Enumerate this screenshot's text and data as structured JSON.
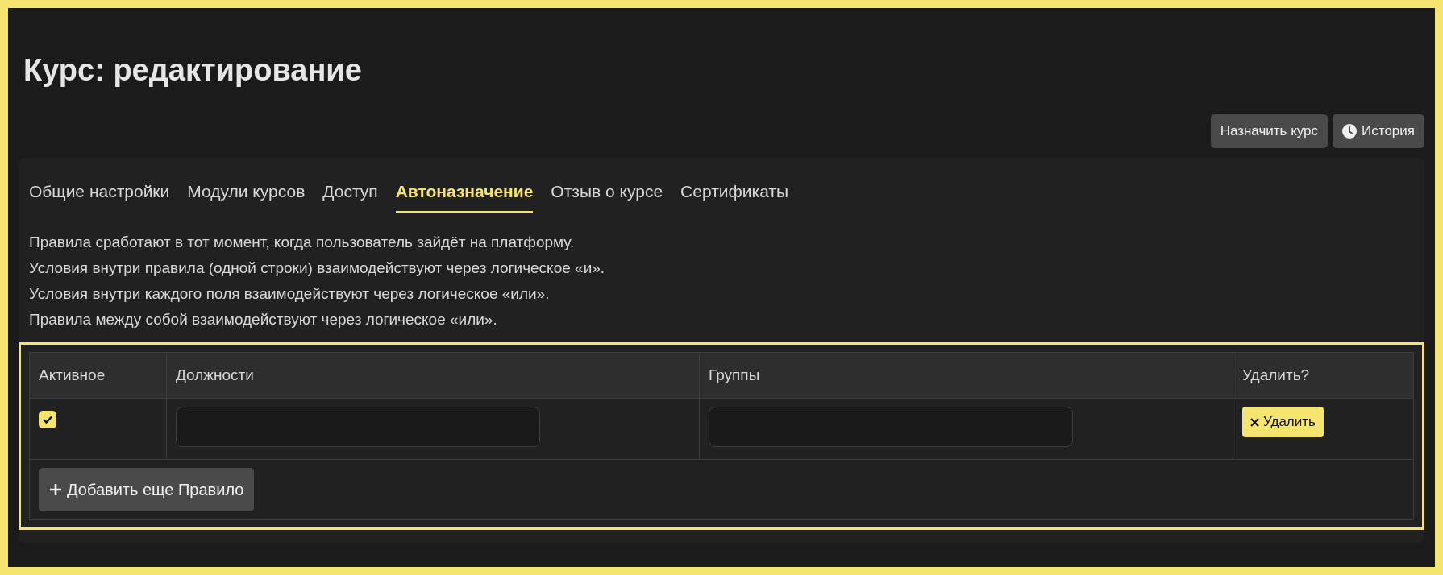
{
  "page": {
    "title": "Курс: редактирование"
  },
  "header_buttons": [
    {
      "label": "Назначить курс",
      "kind": "plain"
    },
    {
      "label": "История",
      "kind": "clock"
    }
  ],
  "tabs": [
    {
      "label": "Общие настройки",
      "selected": false
    },
    {
      "label": "Модули курсов",
      "selected": false
    },
    {
      "label": "Доступ",
      "selected": false
    },
    {
      "label": "Автоназначение",
      "selected": true
    },
    {
      "label": "Отзыв о курсе",
      "selected": false
    },
    {
      "label": "Сертификаты",
      "selected": false
    }
  ],
  "description": [
    "Правила сработают в тот момент, когда пользователь зайдёт на платформу.",
    "Условия внутри правила (одной строки) взаимодействуют через логическое «и».",
    "Условия внутри каждого поля взаимодействуют через логическое «или».",
    "Правила между собой взаимодействуют через логическое «или»."
  ],
  "table": {
    "columns": [
      "Активное",
      "Должности",
      "Группы",
      "Удалить?"
    ],
    "rows": [
      {
        "active": true,
        "delete_label": "Удалить"
      }
    ],
    "add_button": "Добавить еще Правило"
  }
}
